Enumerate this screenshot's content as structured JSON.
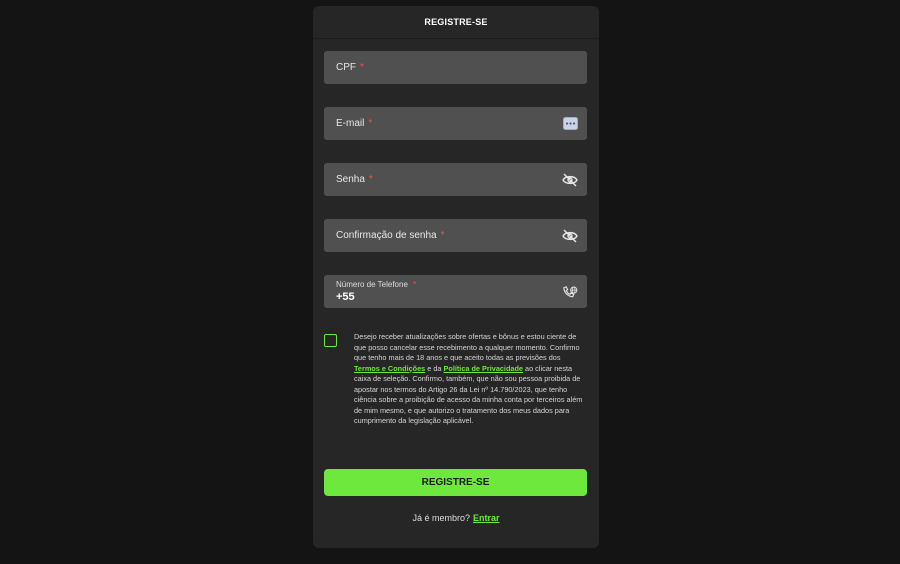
{
  "header": {
    "title": "REGISTRE-SE"
  },
  "fields": {
    "cpf": {
      "label": "CPF",
      "required": "*"
    },
    "email": {
      "label": "E-mail",
      "required": "*"
    },
    "password": {
      "label": "Senha",
      "required": "*"
    },
    "password_confirm": {
      "label": "Confirmação de senha",
      "required": "*"
    },
    "phone": {
      "label": "Número de Telefone",
      "required": "*",
      "value": "+55"
    }
  },
  "icons": {
    "email": "email-autofill-icon",
    "password": "eye-off-icon",
    "password_confirm": "eye-off-icon",
    "phone": "phone-globe-icon"
  },
  "consent": {
    "text_1": "Desejo receber atualizações sobre ofertas e bônus e estou ciente de que posso cancelar esse recebimento a qualquer momento. Confirmo que tenho mais de 18 anos e que aceito todas as previsões dos",
    "terms_link": "Termos e Condições",
    "text_2": "e da",
    "privacy_link": "Política de Privacidade",
    "text_3": "ao clicar nesta caixa de seleção. Confirmo, também, que não sou pessoa proibida de apostar nos termos do Artigo 26 da Lei nº 14.790/2023, que tenho ciência sobre a proibição de acesso da minha conta por terceiros além de mim mesmo, e que autorizo o tratamento dos meus dados para cumprimento da legislação aplicável."
  },
  "submit": {
    "label": "REGISTRE-SE"
  },
  "footer": {
    "member_text": "Já é membro?",
    "login_link": "Entrar"
  },
  "colors": {
    "accent": "#6ee83c",
    "panel": "#262626",
    "field": "#505050",
    "background": "#141414",
    "required": "#ff4d4d"
  }
}
